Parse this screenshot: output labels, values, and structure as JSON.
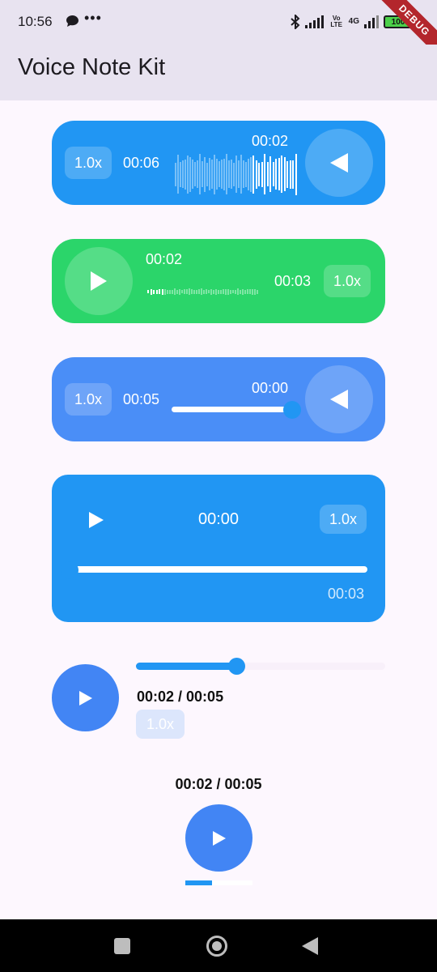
{
  "status_bar": {
    "time": "10:56",
    "dots": "•••",
    "volte": "Vo LTE",
    "network": "4G",
    "battery": "100",
    "debug_label": "DEBUG"
  },
  "app_bar": {
    "title": "Voice Note Kit"
  },
  "player1": {
    "speed": "1.0x",
    "duration": "00:06",
    "position": "00:02",
    "progress": 0.33,
    "color": "#2196F3"
  },
  "player2": {
    "position": "00:02",
    "duration": "00:03",
    "speed": "1.0x",
    "progress": 0.1,
    "color": "#2BD56A"
  },
  "player3": {
    "speed": "1.0x",
    "duration": "00:05",
    "position": "00:00",
    "color": "#4A8EF7"
  },
  "player4": {
    "position": "00:00",
    "speed": "1.0x",
    "duration": "00:03",
    "progress": 0.0,
    "color": "#2196F3"
  },
  "player5": {
    "time": "00:02 / 00:05",
    "speed": "1.0x",
    "progress": 0.4
  },
  "player6": {
    "time": "00:02 / 00:05",
    "progress": 0.4
  },
  "nav_bar": {
    "icons": [
      "recents-icon",
      "home-icon",
      "back-icon"
    ]
  }
}
